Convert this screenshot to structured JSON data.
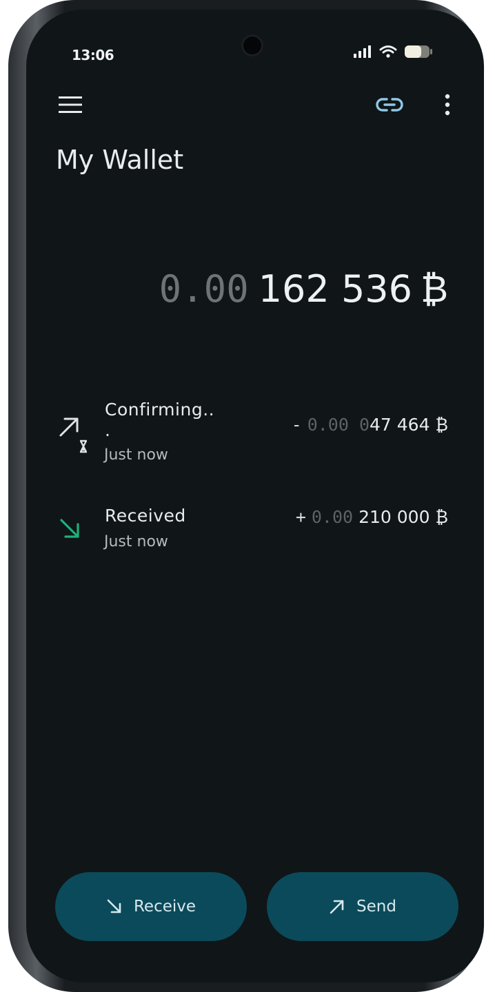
{
  "status_bar": {
    "time": "13:06"
  },
  "toolbar": {
    "menu_icon": "hamburger-menu-icon",
    "link_icon": "link-icon",
    "overflow_icon": "more-vertical-icon",
    "accent_color": "#8ec9e6"
  },
  "wallet": {
    "title": "My Wallet",
    "balance_dim": "0.00",
    "balance_main": "162 536",
    "currency_symbol": "₿"
  },
  "transactions": [
    {
      "status_line1": "Confirming..",
      "status_line2": ".",
      "time": "Just now",
      "sign": "-",
      "amount_dim": "0.00 0",
      "amount_main": "47 464",
      "currency_symbol": "₿",
      "icon": "send-pending-icon",
      "icon_color": "#e0e3e4"
    },
    {
      "status_line1": "Received",
      "time": "Just now",
      "sign": "+",
      "amount_dim": "0.00",
      "amount_main": "210 000",
      "currency_symbol": "₿",
      "icon": "received-arrow-icon",
      "icon_color": "#1fb07a"
    }
  ],
  "actions": {
    "receive_label": "Receive",
    "send_label": "Send",
    "button_color": "#0b4a5a"
  }
}
